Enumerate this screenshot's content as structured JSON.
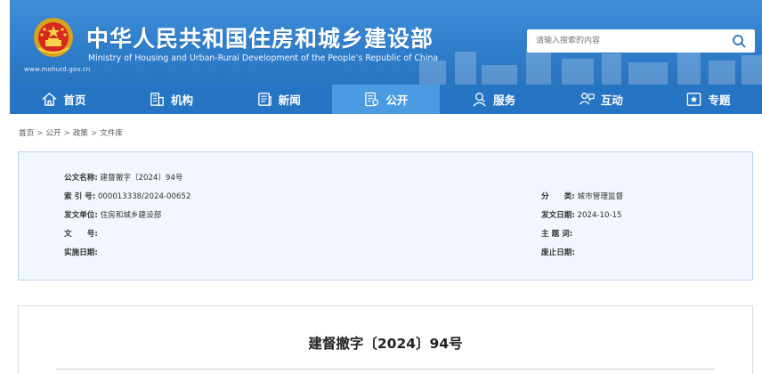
{
  "header": {
    "title_cn": "中华人民共和国住房和城乡建设部",
    "title_en": "Ministry of Housing and Urban-Rural Development of the People’s Republic of China",
    "site_url": "www.mohurd.gov.cn",
    "search_placeholder": "请输入搜索的内容",
    "search_icon": "search-icon"
  },
  "nav": {
    "items": [
      {
        "label": "首页",
        "icon": "home-icon"
      },
      {
        "label": "机构",
        "icon": "building-icon"
      },
      {
        "label": "新闻",
        "icon": "news-icon"
      },
      {
        "label": "公开",
        "icon": "document-icon",
        "active": true
      },
      {
        "label": "服务",
        "icon": "service-icon"
      },
      {
        "label": "互动",
        "icon": "interaction-icon"
      },
      {
        "label": "专题",
        "icon": "topic-icon"
      }
    ]
  },
  "breadcrumb": {
    "items": [
      "首页",
      "公开",
      "政策",
      "文件库"
    ],
    "separator": ">"
  },
  "meta": {
    "doc_name_label": "公文名称:",
    "doc_name": "建督撤字〔2024〕94号",
    "index_label": "索 引 号:",
    "index": "000013338/2024-00652",
    "issuer_label": "发文单位:",
    "issuer": "住房和城乡建设部",
    "doc_no_label": "文　　号:",
    "doc_no": "",
    "effective_label": "实施日期:",
    "effective": "",
    "category_label": "分　　类:",
    "category": "城市管理监督",
    "issue_date_label": "发文日期:",
    "issue_date": "2024-10-15",
    "keywords_label": "主 题 词:",
    "keywords": "",
    "expiry_label": "废止日期:",
    "expiry": ""
  },
  "article": {
    "title": "建督撤字〔2024〕94号"
  },
  "colors": {
    "header_blue": "#2f7fcc",
    "nav_blue": "#2674c4",
    "nav_active": "#4a9be2",
    "meta_bg": "#f1f7fd",
    "meta_border": "#bcd3ea"
  }
}
